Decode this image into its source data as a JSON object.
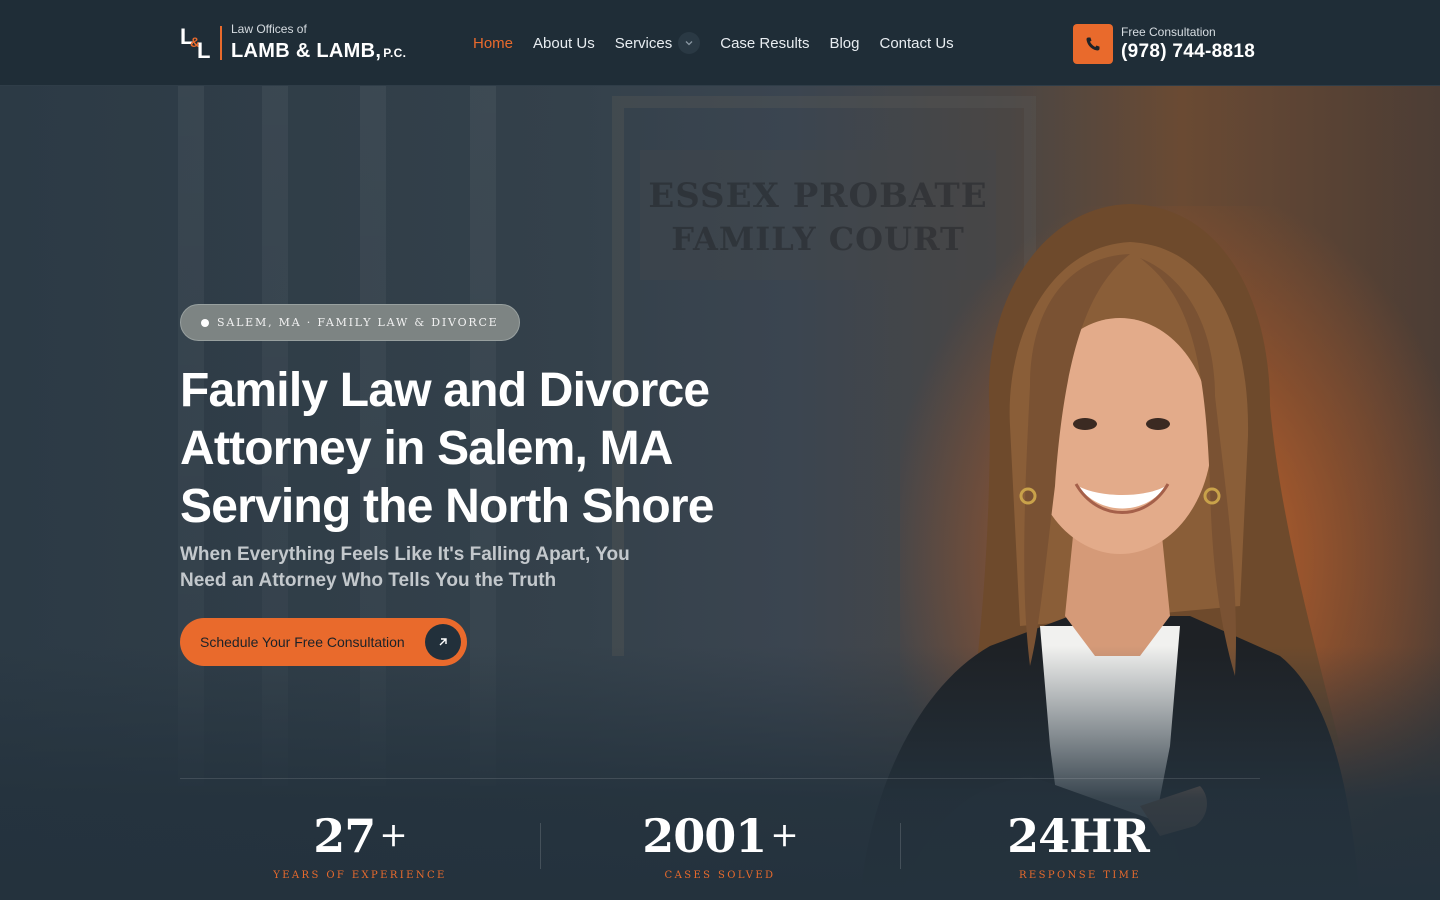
{
  "header": {
    "logo": {
      "mark_l1": "L",
      "mark_amp": "&",
      "mark_l2": "L",
      "subtitle": "Law Offices of",
      "name": "LAMB & LAMB,",
      "suffix": "P.C."
    },
    "nav": [
      {
        "label": "Home",
        "active": true
      },
      {
        "label": "About Us"
      },
      {
        "label": "Services",
        "has_dropdown": true
      },
      {
        "label": "Case Results"
      },
      {
        "label": "Blog"
      },
      {
        "label": "Contact Us"
      }
    ],
    "cta": {
      "label": "Free Consultation",
      "phone": "(978) 744-8818",
      "icon": "phone-icon"
    }
  },
  "hero": {
    "background_sign": {
      "line1": "ESSEX PROBATE",
      "line2": "FAMILY COURT"
    },
    "badge": "SALEM, MA · FAMILY LAW & DIVORCE",
    "title_lines": [
      "Family Law and Divorce",
      "Attorney in Salem, MA",
      "Serving the North Shore"
    ],
    "subtitle_lines": [
      "When Everything Feels Like It's Falling Apart, You",
      "Need an Attorney Who Tells You the Truth"
    ],
    "button": {
      "label": "Schedule Your Free Consultation",
      "icon": "arrow-up-right-icon"
    }
  },
  "stats": [
    {
      "value": "27",
      "suffix": "+",
      "label": "YEARS OF EXPERIENCE"
    },
    {
      "value": "2001",
      "suffix": "+",
      "label": "CASES SOLVED"
    },
    {
      "value": "24HR",
      "suffix": "",
      "label": "RESPONSE TIME"
    }
  ],
  "colors": {
    "accent": "#e96a2c",
    "header_bg": "#1f2d37",
    "page_bg": "#24323d"
  }
}
